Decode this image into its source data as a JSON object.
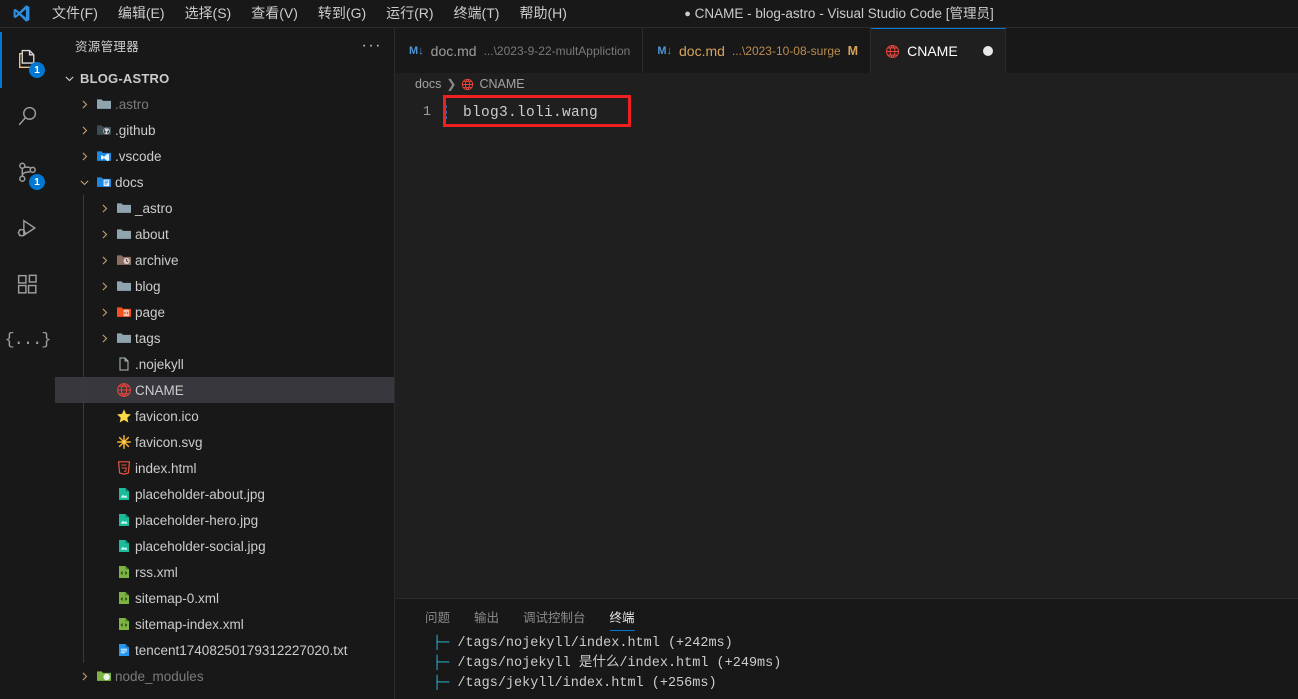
{
  "titlebar": {
    "logo_icon": "vscode-logo",
    "window_title": "CNAME - blog-astro - Visual Studio Code [管理员]",
    "dirty_dot": "●",
    "menu": [
      {
        "label": "文件(F)",
        "name": "menu-file"
      },
      {
        "label": "编辑(E)",
        "name": "menu-edit"
      },
      {
        "label": "选择(S)",
        "name": "menu-selection"
      },
      {
        "label": "查看(V)",
        "name": "menu-view"
      },
      {
        "label": "转到(G)",
        "name": "menu-goto"
      },
      {
        "label": "运行(R)",
        "name": "menu-run"
      },
      {
        "label": "终端(T)",
        "name": "menu-terminal"
      },
      {
        "label": "帮助(H)",
        "name": "menu-help"
      }
    ]
  },
  "activitybar": {
    "items": [
      {
        "icon": "explorer-icon",
        "badge": "1",
        "active": true
      },
      {
        "icon": "search-icon",
        "badge": ""
      },
      {
        "icon": "source-control-icon",
        "badge": "1"
      },
      {
        "icon": "run-and-debug-icon",
        "badge": ""
      },
      {
        "icon": "extensions-icon",
        "badge": ""
      },
      {
        "icon": "braces-icon",
        "badge": "",
        "glyph": "{...}"
      }
    ]
  },
  "sidebar": {
    "title": "资源管理器",
    "more_actions": "···",
    "root": {
      "label": "BLOG-ASTRO",
      "expanded": true
    },
    "items": [
      {
        "name": ".astro",
        "type": "folder",
        "depth": 1,
        "expanded": false,
        "icon": "folder-plain-icon",
        "dim": true
      },
      {
        "name": ".github",
        "type": "folder",
        "depth": 1,
        "expanded": false,
        "icon": "folder-github-icon",
        "dim": false
      },
      {
        "name": ".vscode",
        "type": "folder",
        "depth": 1,
        "expanded": false,
        "icon": "folder-vscode-icon",
        "dim": false
      },
      {
        "name": "docs",
        "type": "folder",
        "depth": 1,
        "expanded": true,
        "icon": "folder-docs-icon",
        "dim": false
      },
      {
        "name": "_astro",
        "type": "folder",
        "depth": 2,
        "expanded": false,
        "icon": "folder-plain-icon",
        "dim": false
      },
      {
        "name": "about",
        "type": "folder",
        "depth": 2,
        "expanded": false,
        "icon": "folder-plain-icon",
        "dim": false
      },
      {
        "name": "archive",
        "type": "folder",
        "depth": 2,
        "expanded": false,
        "icon": "folder-archive-icon",
        "dim": false
      },
      {
        "name": "blog",
        "type": "folder",
        "depth": 2,
        "expanded": false,
        "icon": "folder-plain-icon",
        "dim": false
      },
      {
        "name": "page",
        "type": "folder",
        "depth": 2,
        "expanded": false,
        "icon": "folder-page-icon",
        "dim": false
      },
      {
        "name": "tags",
        "type": "folder",
        "depth": 2,
        "expanded": false,
        "icon": "folder-plain-icon",
        "dim": false
      },
      {
        "name": ".nojekyll",
        "type": "file",
        "depth": 2,
        "icon": "file-blank-icon",
        "dim": false
      },
      {
        "name": "CNAME",
        "type": "file",
        "depth": 2,
        "icon": "globe-icon",
        "dim": false,
        "selected": true
      },
      {
        "name": "favicon.ico",
        "type": "file",
        "depth": 2,
        "icon": "star-icon",
        "dim": false
      },
      {
        "name": "favicon.svg",
        "type": "file",
        "depth": 2,
        "icon": "svg-star-icon",
        "dim": false
      },
      {
        "name": "index.html",
        "type": "file",
        "depth": 2,
        "icon": "html5-icon",
        "dim": false
      },
      {
        "name": "placeholder-about.jpg",
        "type": "file",
        "depth": 2,
        "icon": "image-icon",
        "dim": false
      },
      {
        "name": "placeholder-hero.jpg",
        "type": "file",
        "depth": 2,
        "icon": "image-icon",
        "dim": false
      },
      {
        "name": "placeholder-social.jpg",
        "type": "file",
        "depth": 2,
        "icon": "image-icon",
        "dim": false
      },
      {
        "name": "rss.xml",
        "type": "file",
        "depth": 2,
        "icon": "xml-icon",
        "dim": false
      },
      {
        "name": "sitemap-0.xml",
        "type": "file",
        "depth": 2,
        "icon": "xml-icon",
        "dim": false
      },
      {
        "name": "sitemap-index.xml",
        "type": "file",
        "depth": 2,
        "icon": "xml-icon",
        "dim": false
      },
      {
        "name": "tencent17408250179312227020.txt",
        "type": "file",
        "depth": 2,
        "icon": "text-file-icon",
        "dim": false
      },
      {
        "name": "node_modules",
        "type": "folder",
        "depth": 1,
        "expanded": false,
        "icon": "folder-npm-icon",
        "dim": true
      }
    ]
  },
  "editor": {
    "tabs": [
      {
        "name": "doc.md",
        "description": "...\\2023-9-22-multAppliction",
        "icon": "markdown-icon",
        "icon_label": "M↓",
        "git_status": "",
        "active": false,
        "modified": false,
        "dirty": false
      },
      {
        "name": "doc.md",
        "description": "...\\2023-10-08-surge",
        "icon": "markdown-icon",
        "icon_label": "M↓",
        "git_status": "M",
        "active": false,
        "modified": true,
        "dirty": false
      },
      {
        "name": "CNAME",
        "description": "",
        "icon": "globe-icon",
        "icon_label": "",
        "git_status": "",
        "active": true,
        "modified": false,
        "dirty": true
      }
    ],
    "breadcrumb": {
      "folder": "docs",
      "separator": "❯",
      "file": "CNAME",
      "file_icon": "globe-icon"
    },
    "line_number": "1",
    "line_text": "blog3.loli.wang",
    "annotation_color": "#ee2020",
    "gutter_change_color": "#2d6bb5"
  },
  "panel": {
    "tabs": [
      {
        "label": "问题",
        "active": false
      },
      {
        "label": "输出",
        "active": false
      },
      {
        "label": "调试控制台",
        "active": false
      },
      {
        "label": "终端",
        "active": true
      }
    ],
    "terminal_lines": [
      {
        "branch": "├─ ",
        "text": "/tags/nojekyll/index.html (+242ms)"
      },
      {
        "branch": "├─ ",
        "text": "/tags/nojekyll 是什么/index.html (+249ms)"
      },
      {
        "branch": "├─ ",
        "text": "/tags/jekyll/index.html (+256ms)"
      }
    ]
  },
  "colors": {
    "accent": "#0078d4",
    "background": "#1f1f1f",
    "chrome": "#181818",
    "selection": "#37373d",
    "modified_text": "#d7a35c",
    "terminal_branch": "#29b8db"
  }
}
